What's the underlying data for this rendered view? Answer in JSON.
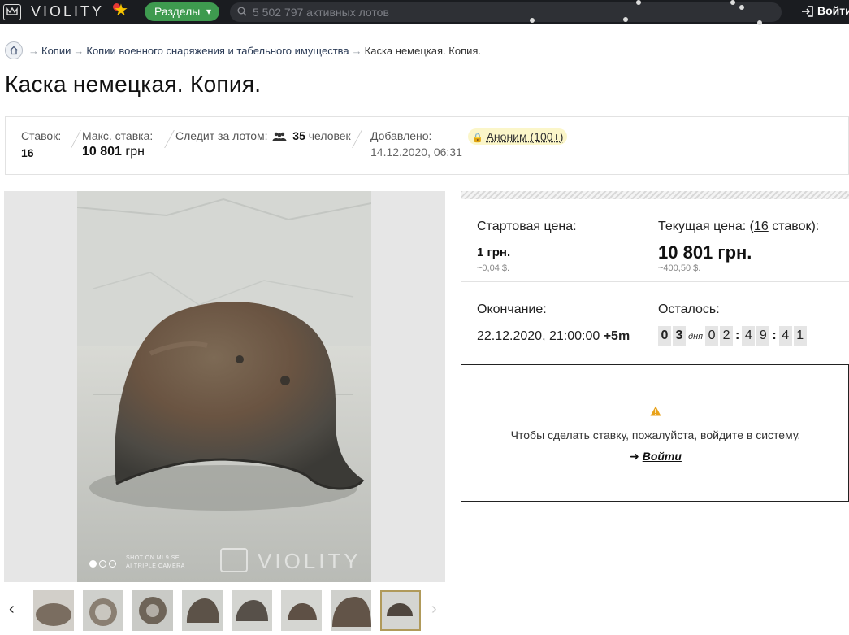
{
  "header": {
    "logo_text": "VIOLITY",
    "sections_label": "Разделы",
    "search_placeholder": "5 502 797 активных лотов",
    "login_label": "Войти"
  },
  "breadcrumb": {
    "items": [
      "Копии",
      "Копии военного снаряжения и табельного имущества"
    ],
    "current": "Каска немецкая. Копия."
  },
  "page_title": "Каска немецкая. Копия.",
  "stats": {
    "bids_label": "Ставок:",
    "bids_value": "16",
    "max_bid_label": "Макс. ставка:",
    "max_bid_value": "10 801",
    "max_bid_currency": "грн",
    "watching_label": "Следит за лотом:",
    "watching_value": "35",
    "watching_unit": "человек",
    "added_label": "Добавлено:",
    "added_value": "14.12.2020, 06:31",
    "seller": "Аноним (100+)"
  },
  "photo": {
    "caption_line1": "SHOT ON MI 9 SE",
    "caption_line2": "AI TRIPLE CAMERA",
    "watermark": "VIOLITY"
  },
  "pricing": {
    "start_label": "Стартовая цена:",
    "start_value": "1  грн.",
    "start_usd": "~0,04  $.",
    "current_label_prefix": "Текущая цена: (",
    "current_bids": "16",
    "current_label_suffix": " ставок):",
    "current_value": "10 801  грн.",
    "current_usd": "~400,50  $.",
    "end_label": "Окончание:",
    "end_value": "22.12.2020, 21:00:00",
    "end_tz": "+5m",
    "remaining_label": "Осталось:",
    "days": [
      "0",
      "3"
    ],
    "days_word": "дня",
    "hours": [
      "0",
      "2"
    ],
    "minutes": [
      "4",
      "9"
    ],
    "seconds": [
      "4",
      "1"
    ]
  },
  "login_box": {
    "message": "Чтобы сделать ставку, пожалуйста, войдите в систему.",
    "link": "Войти"
  },
  "colors": {
    "topbar": "#1a1c20",
    "sections_green": "#3e9a4f",
    "anon_highlight": "#fbf6c9"
  }
}
